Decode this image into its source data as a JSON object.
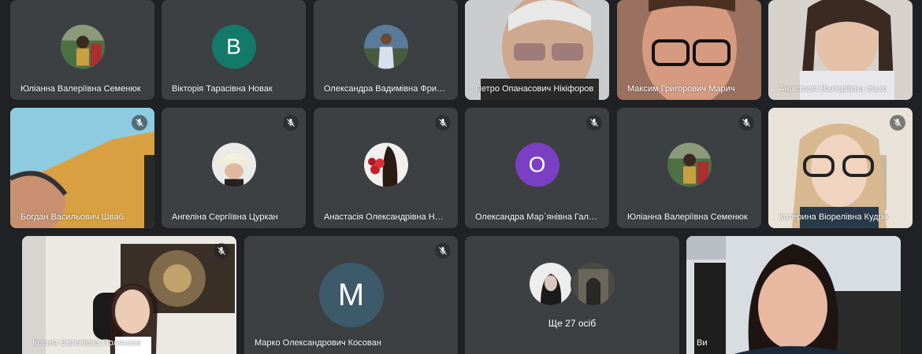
{
  "row1": [
    {
      "name": "Юліанна Валеріївна Семенюк",
      "mode": "photo"
    },
    {
      "name": "Вікторія Тарасівна Новак",
      "mode": "letter",
      "letter": "В",
      "color": "#137a6a"
    },
    {
      "name": "Олександра Вадимівна Фри…",
      "mode": "photo"
    },
    {
      "name": "Петро Опанасович Нікіфоров",
      "mode": "video"
    },
    {
      "name": "Максим Григорович Марич",
      "mode": "video"
    },
    {
      "name": "Анастасія Валеріївна Ілько",
      "mode": "video"
    }
  ],
  "row2": [
    {
      "name": "Богдан Васильович Шваб",
      "mode": "video"
    },
    {
      "name": "Ангеліна Сергіївна Цуркан",
      "mode": "photo"
    },
    {
      "name": "Анастасія Олександрівна Н…",
      "mode": "photo"
    },
    {
      "name": "Олександра Мар`янівна Галі…",
      "mode": "letter",
      "letter": "О",
      "color": "#7b3fc4"
    },
    {
      "name": "Юліанна Валеріївна Семенюк",
      "mode": "photo"
    },
    {
      "name": "Катерина Віорелівна Кудрік",
      "mode": "video"
    }
  ],
  "row3": [
    {
      "name": "Ксенія Євгенівна Полякова",
      "mode": "video"
    },
    {
      "name": "Марко Олександрович Косован",
      "mode": "letter",
      "letter": "М",
      "color": "#3c5a6a"
    },
    {
      "name": "",
      "mode": "more",
      "more_label": "Ще 27 осіб"
    },
    {
      "name": "Ви",
      "mode": "video"
    }
  ],
  "icons": {
    "mic_off": "mic-off-icon"
  }
}
